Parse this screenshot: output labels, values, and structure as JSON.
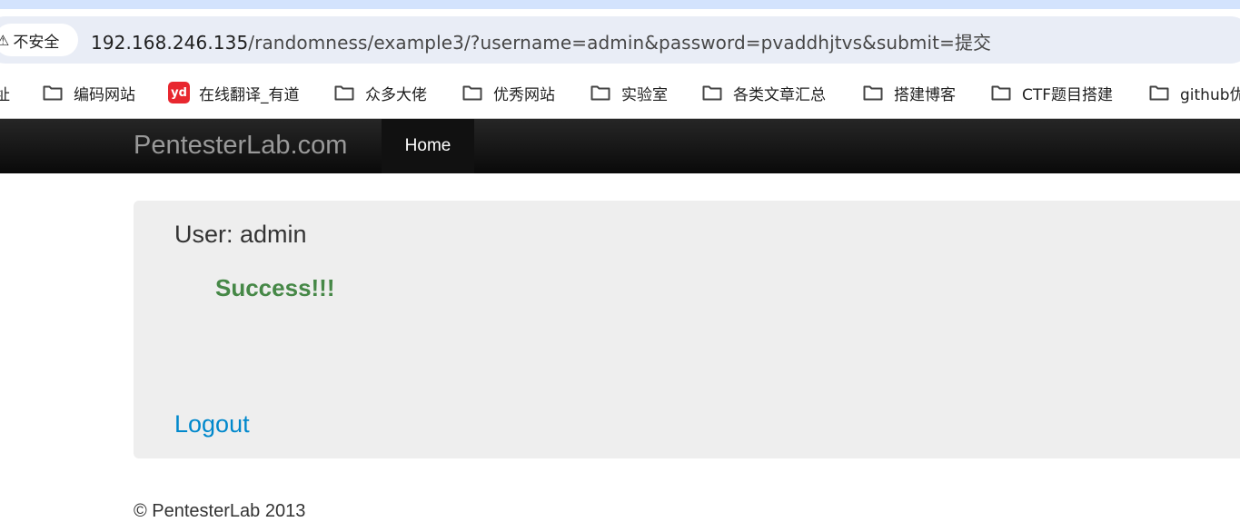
{
  "browser": {
    "security_label": "不安全",
    "url_host": "192.168.246.135",
    "url_path": "/randomness/example3/?username=admin&password=pvaddhjtvs&submit=提交"
  },
  "bookmarks": {
    "partial_first": "址",
    "items": [
      {
        "label": "编码网站",
        "icon": "folder-icon"
      },
      {
        "label": "在线翻译_有道",
        "icon": "youdao-icon",
        "icon_text": "yd"
      },
      {
        "label": "众多大佬",
        "icon": "folder-icon"
      },
      {
        "label": "优秀网站",
        "icon": "folder-icon"
      },
      {
        "label": "实验室",
        "icon": "folder-icon"
      },
      {
        "label": "各类文章汇总",
        "icon": "folder-icon"
      },
      {
        "label": "搭建博客",
        "icon": "folder-icon"
      },
      {
        "label": "CTF题目搭建",
        "icon": "folder-icon"
      },
      {
        "label": "github优",
        "icon": "folder-icon"
      }
    ]
  },
  "navbar": {
    "brand": "PentesterLab.com",
    "home": "Home"
  },
  "hero": {
    "user_line": "User: admin",
    "success": "Success!!!",
    "logout": "Logout"
  },
  "footer": {
    "text": "© PentesterLab 2013"
  },
  "colors": {
    "navbar_bg": "#1b1b1b",
    "hero_bg": "#eeeeee",
    "success": "#468847",
    "link": "#0088cc",
    "youdao": "#e8272f"
  }
}
